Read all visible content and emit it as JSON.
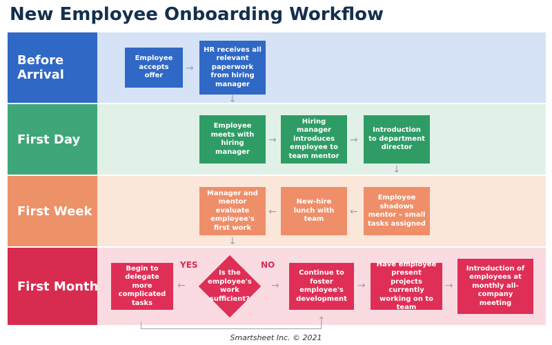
{
  "title": "New Employee Onboarding Workflow",
  "footer": "Smartsheet Inc. © 2021",
  "colors": {
    "blue_label": "#2f68c5",
    "blue_body": "#d6e2f5",
    "blue_node": "#2f68c5",
    "green_label": "#3fa679",
    "green_body": "#e2f1e7",
    "green_node": "#2f9c66",
    "orange_label": "#ed9168",
    "orange_body": "#fbe6da",
    "orange_node": "#ee8f6a",
    "red_label": "#d72b4f",
    "red_body": "#fadbe2",
    "red_node": "#df2f56"
  },
  "lanes": [
    {
      "key": "before",
      "label": "Before Arrival",
      "nodes": [
        {
          "id": "offer",
          "text": "Employee accepts offer"
        },
        {
          "id": "hr",
          "text": "HR receives all relevant paperwork from hiring manager"
        }
      ]
    },
    {
      "key": "day",
      "label": "First Day",
      "nodes": [
        {
          "id": "meet",
          "text": "Employee meets with hiring manager"
        },
        {
          "id": "mentor",
          "text": "Hiring manager introduces employee to team mentor"
        },
        {
          "id": "director",
          "text": "Introduction to department director"
        }
      ]
    },
    {
      "key": "week",
      "label": "First Week",
      "nodes": [
        {
          "id": "eval",
          "text": "Manager and mentor evaluate employee's first work"
        },
        {
          "id": "lunch",
          "text": "New-hire lunch with team"
        },
        {
          "id": "shadow",
          "text": "Employee shadows mentor – small tasks assigned"
        }
      ]
    },
    {
      "key": "month",
      "label": "First Month",
      "decision": {
        "id": "sufficient",
        "text": "Is the employee's work sufficient?",
        "yes": "YES",
        "no": "NO"
      },
      "nodes": [
        {
          "id": "delegate",
          "text": "Begin to delegate more complicated tasks"
        },
        {
          "id": "foster",
          "text": "Continue to foster employee's development"
        },
        {
          "id": "present",
          "text": "Have employee present projects currently working on to team"
        },
        {
          "id": "allcompany",
          "text": "Introduction of employees at monthly all-company meeting"
        }
      ]
    }
  ]
}
